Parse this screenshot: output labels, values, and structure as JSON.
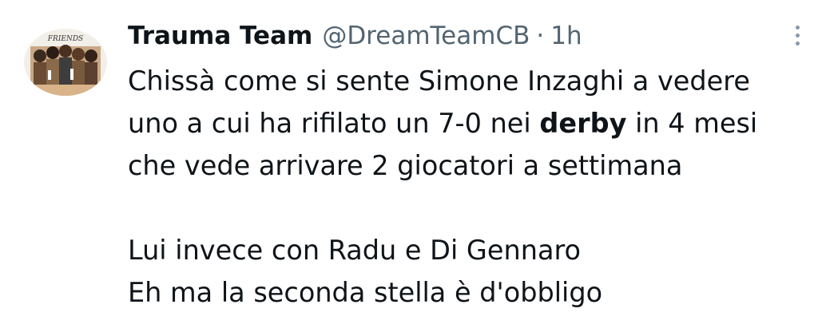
{
  "tweet": {
    "author": {
      "display_name": "Trauma Team",
      "handle": "@DreamTeamCB",
      "avatar_text": "FRIENDS"
    },
    "separator": "·",
    "timestamp": "1h",
    "more_icon": "more-vertical-icon",
    "text": {
      "line1": "Chissà come si sente Simone Inzaghi a vedere",
      "line2_pre": "uno a cui ha rifilato un 7-0 nei ",
      "line2_bold": "derby",
      "line2_post": " in 4 mesi",
      "line3": "che vede arrivare 2 giocatori a settimana",
      "line4": "Lui invece con Radu e Di Gennaro",
      "line5": "Eh ma la seconda stella è d'obbligo"
    }
  }
}
